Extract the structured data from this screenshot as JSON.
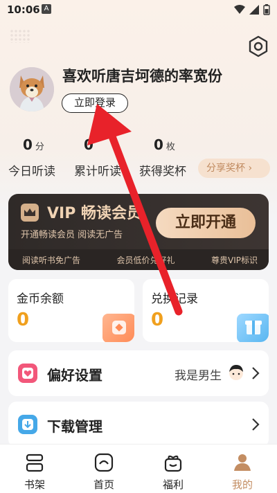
{
  "status_bar": {
    "time": "10:06",
    "notice_badge": "A"
  },
  "profile": {
    "username": "喜欢听唐吉坷德的率宽份",
    "login_button": "立即登录"
  },
  "stats": [
    {
      "value": "0",
      "unit": "分",
      "label": "今日听读"
    },
    {
      "value": "0",
      "unit": "",
      "label": "累计听读"
    },
    {
      "value": "0",
      "unit": "枚",
      "label": "获得奖杯"
    }
  ],
  "share_button": "分享奖杯 ›",
  "vip": {
    "title": "VIP 畅读会员",
    "subtitle": "开通畅读会员 阅读无广告",
    "cta": "立即开通",
    "benefits": [
      "阅读听书免广告",
      "会员低价兑好礼",
      "尊贵VIP标识"
    ]
  },
  "cards": {
    "coins": {
      "label": "金币余额",
      "value": "0"
    },
    "exchange": {
      "label": "兑换记录",
      "value": "0"
    }
  },
  "menu": {
    "preferences": {
      "label": "偏好设置",
      "value": "我是男生"
    },
    "downloads": {
      "label": "下载管理"
    }
  },
  "tabs": [
    {
      "label": "书架",
      "icon": "bookshelf-icon"
    },
    {
      "label": "首页",
      "icon": "home-icon"
    },
    {
      "label": "福利",
      "icon": "gift-box-icon"
    },
    {
      "label": "我的",
      "icon": "profile-icon",
      "active": true
    }
  ],
  "colors": {
    "accent": "#c38d62",
    "vip_bg": "#2f2a28",
    "coin": "#f0a01e",
    "arrow": "#e8222a"
  }
}
